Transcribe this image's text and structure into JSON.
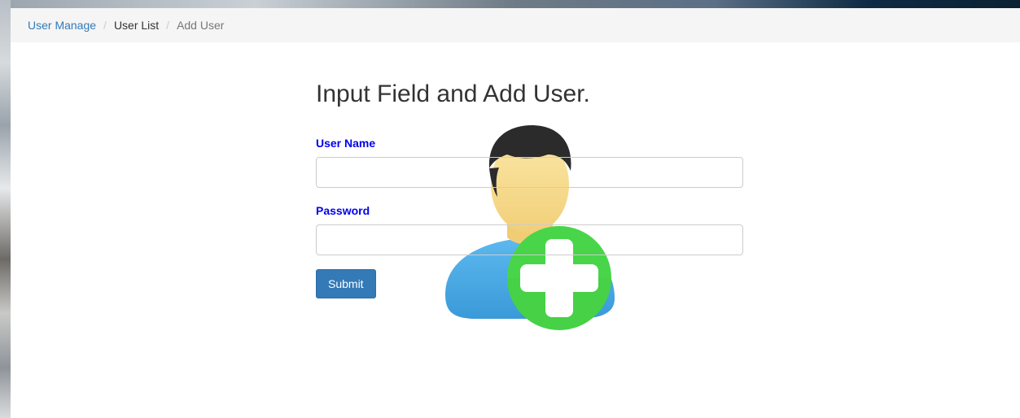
{
  "breadcrumb": {
    "items": [
      "User Manage",
      "User List",
      "Add User"
    ],
    "separator": "/"
  },
  "form": {
    "title": "Input Field and Add User.",
    "username_label": "User Name",
    "username_value": "",
    "password_label": "Password",
    "password_value": "",
    "submit_label": "Submit"
  },
  "illustration": {
    "icon": "add-user-icon"
  },
  "colors": {
    "link": "#337ab7",
    "label": "#0000ee",
    "button": "#337ab7",
    "plus": "#44d444"
  }
}
